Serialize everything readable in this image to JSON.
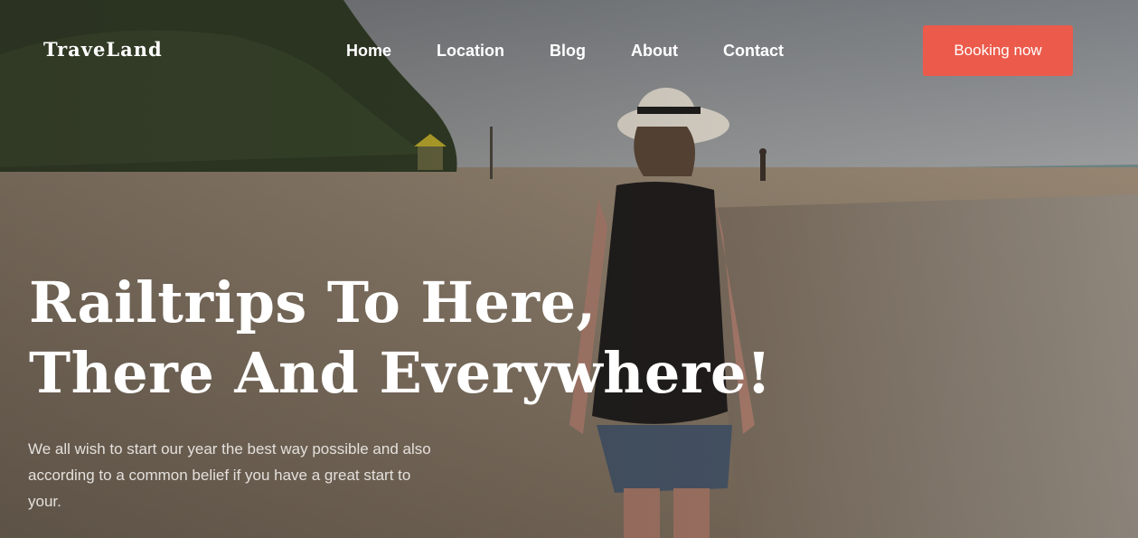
{
  "brand": {
    "logo_text": "TraveLand"
  },
  "nav": {
    "items": [
      {
        "label": "Home"
      },
      {
        "label": "Location"
      },
      {
        "label": "Blog"
      },
      {
        "label": "About"
      },
      {
        "label": "Contact"
      }
    ],
    "cta_label": "Booking now"
  },
  "hero": {
    "headline_line1": "Railtrips To Here,",
    "headline_line2": "There And Everywhere!",
    "subtext": "We all wish to start our year the best way possible and also according to a common belief if you have a great start to your.",
    "background_image": "beach-walker-photo"
  },
  "colors": {
    "accent": "#ec5a4b",
    "text_light": "#ffffff",
    "subtext": "#e4e0dc"
  }
}
